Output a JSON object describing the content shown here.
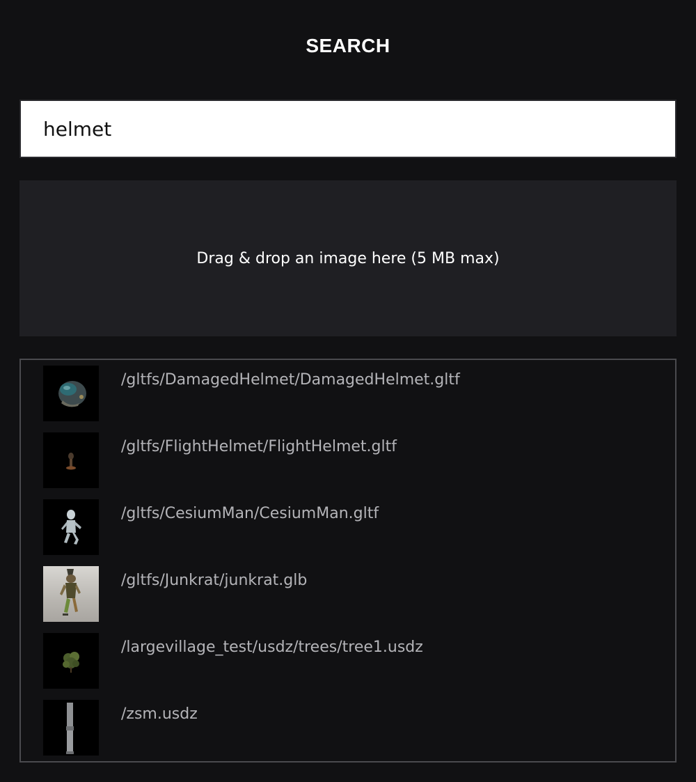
{
  "header": {
    "title": "SEARCH"
  },
  "search": {
    "value": "helmet"
  },
  "dropzone": {
    "label": "Drag & drop an image here (5 MB max)"
  },
  "results": [
    {
      "path": "/gltfs/DamagedHelmet/DamagedHelmet.gltf",
      "thumbnail": "damaged-helmet-icon"
    },
    {
      "path": "/gltfs/FlightHelmet/FlightHelmet.gltf",
      "thumbnail": "flight-helmet-icon"
    },
    {
      "path": "/gltfs/CesiumMan/CesiumMan.gltf",
      "thumbnail": "cesium-man-icon"
    },
    {
      "path": "/gltfs/Junkrat/junkrat.glb",
      "thumbnail": "junkrat-icon"
    },
    {
      "path": "/largevillage_test/usdz/trees/tree1.usdz",
      "thumbnail": "tree-icon"
    },
    {
      "path": "/zsm.usdz",
      "thumbnail": "zsm-model-icon"
    }
  ],
  "colors": {
    "background": "#111113",
    "dropzone": "#1f1f23",
    "result_text": "#b4b4b8"
  }
}
